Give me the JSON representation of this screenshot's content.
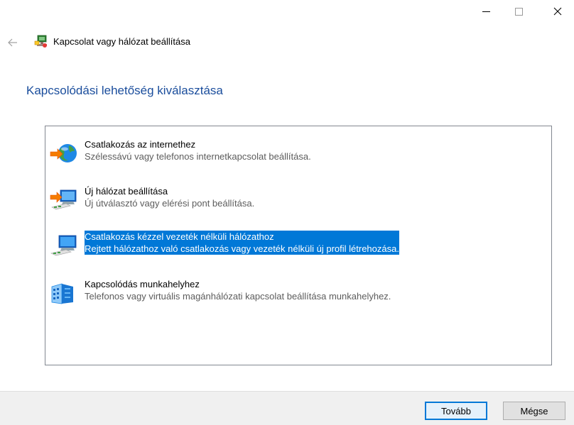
{
  "window": {
    "controls": {
      "minimize": "minimize-icon",
      "maximize": "maximize-icon",
      "close": "close-icon"
    }
  },
  "header": {
    "back_icon": "back-arrow-icon",
    "icon": "network-setup-icon",
    "title": "Kapcsolat vagy hálózat beállítása"
  },
  "main": {
    "heading": "Kapcsolódási lehetőség kiválasztása",
    "options": [
      {
        "icon": "globe-internet-icon",
        "title": "Csatlakozás az internethez",
        "description": "Szélessávú vagy telefonos internetkapcsolat beállítása.",
        "selected": false
      },
      {
        "icon": "new-network-icon",
        "title": "Új hálózat beállítása",
        "description": "Új útválasztó vagy elérési pont beállítása.",
        "selected": false
      },
      {
        "icon": "wireless-network-icon",
        "title": "Csatlakozás kézzel vezeték nélküli hálózathoz",
        "description": "Rejtett hálózathoz való csatlakozás vagy vezeték nélküli új profil létrehozása.",
        "selected": true
      },
      {
        "icon": "workplace-building-icon",
        "title": "Kapcsolódás munkahelyhez",
        "description": "Telefonos vagy virtuális magánhálózati kapcsolat beállítása munkahelyhez.",
        "selected": false
      }
    ]
  },
  "footer": {
    "next_label": "Tovább",
    "cancel_label": "Mégse"
  },
  "colors": {
    "heading": "#1a4d9c",
    "selection": "#0078d7",
    "footer_bg": "#f0f0f0"
  }
}
